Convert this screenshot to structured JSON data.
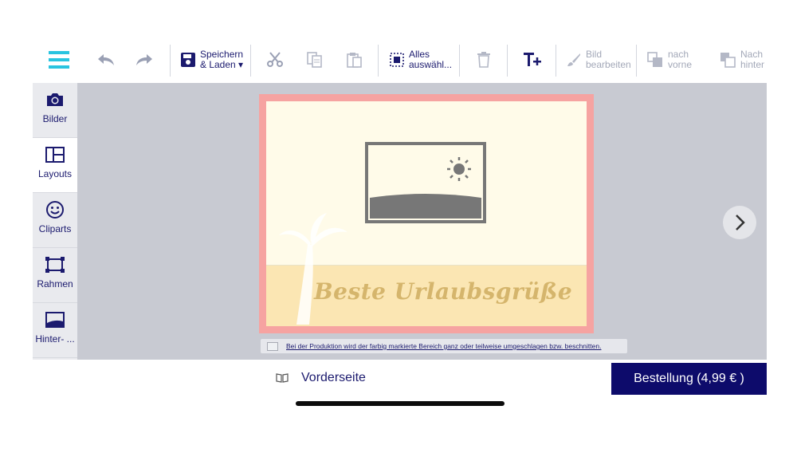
{
  "toolbar": {
    "save_label_line1": "Speichern",
    "save_label_line2": "& Laden ▾",
    "select_all_line1": "Alles",
    "select_all_line2": "auswähl...",
    "edit_image_line1": "Bild",
    "edit_image_line2": "bearbeiten",
    "to_front_line1": "nach",
    "to_front_line2": "vorne",
    "to_back_line1": "Nach",
    "to_back_line2": "hinten",
    "icons": [
      "menu-icon",
      "undo-icon",
      "redo-icon",
      "save-icon",
      "scissors-icon",
      "copy-icon",
      "paste-icon",
      "select-all-icon",
      "trash-icon",
      "add-text-icon",
      "brush-icon",
      "bring-front-icon",
      "send-back-icon"
    ],
    "accent_color": "#29c4e0"
  },
  "sidebar": {
    "items": [
      {
        "label": "Bilder",
        "icon": "camera-icon"
      },
      {
        "label": "Layouts",
        "icon": "layout-icon"
      },
      {
        "label": "Cliparts",
        "icon": "smiley-icon"
      },
      {
        "label": "Rahmen",
        "icon": "frame-icon"
      },
      {
        "label": "Hinter- ...",
        "icon": "background-icon"
      }
    ],
    "active_index": 1
  },
  "canvas": {
    "greeting_text": "Beste Urlaubsgrüße",
    "notice_text": "Bei der Produktion wird der farbig markierte Bereich ganz oder teilweise umgeschlagen bzw. beschnitten.",
    "bleed_color": "#f6a3a1"
  },
  "bottom": {
    "page_label": "Vorderseite",
    "order_button": "Bestellung (4,99 € )",
    "order_color": "#0d0b6b"
  }
}
